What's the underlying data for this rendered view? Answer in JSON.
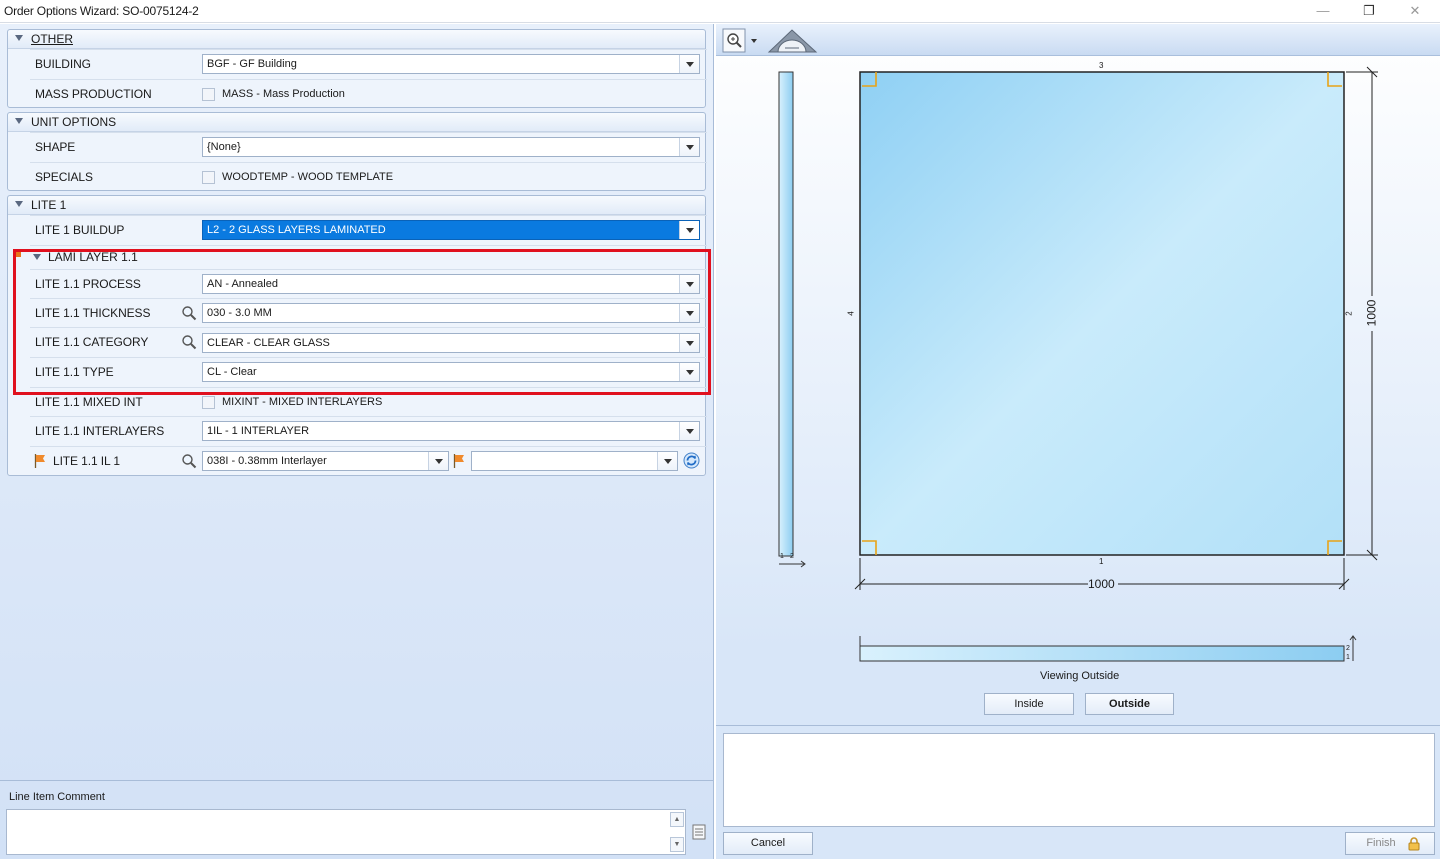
{
  "window": {
    "title": "Order Options Wizard: SO-0075124-2"
  },
  "groups": {
    "other": {
      "title": "OTHER"
    },
    "unit_options": {
      "title": "UNIT OPTIONS"
    },
    "lite1": {
      "title": "LITE 1"
    },
    "lami": {
      "title": "LAMI LAYER 1.1"
    }
  },
  "fields": {
    "building": {
      "label": "BUILDING",
      "value": "BGF - GF Building"
    },
    "mass_production": {
      "label": "MASS PRODUCTION",
      "option": "MASS - Mass Production",
      "checked": false
    },
    "shape": {
      "label": "SHAPE",
      "value": "{None}"
    },
    "specials": {
      "label": "SPECIALS",
      "option": "WOODTEMP - WOOD TEMPLATE",
      "checked": false
    },
    "lite1_buildup": {
      "label": "LITE 1 BUILDUP",
      "value": "L2 - 2 GLASS LAYERS LAMINATED"
    },
    "process": {
      "label": "LITE 1.1 PROCESS",
      "value": "AN - Annealed"
    },
    "thickness": {
      "label": "LITE 1.1 THICKNESS",
      "value": "030 - 3.0 MM"
    },
    "category": {
      "label": "LITE 1.1 CATEGORY",
      "value": "CLEAR - CLEAR GLASS"
    },
    "type": {
      "label": "LITE 1.1 TYPE",
      "value": "CL - Clear"
    },
    "mixed_int": {
      "label": "LITE 1.1 MIXED INT",
      "option": "MIXINT - MIXED INTERLAYERS",
      "checked": false
    },
    "interlayers": {
      "label": "LITE 1.1 INTERLAYERS",
      "value": "1IL - 1 INTERLAYER"
    },
    "il1": {
      "label": "LITE 1.1 IL 1",
      "value": "038I - 0.38mm Interlayer",
      "value2": ""
    }
  },
  "comment": {
    "label": "Line Item Comment",
    "value": ""
  },
  "preview": {
    "width": "1000",
    "height": "1000",
    "edge_top": "3",
    "edge_bottom": "1",
    "edge_left": "4",
    "edge_right": "2",
    "side_labels": [
      "1",
      "2"
    ],
    "viewing": "Viewing Outside",
    "inside_label": "Inside",
    "outside_label": "Outside"
  },
  "buttons": {
    "cancel": "Cancel",
    "finish": "Finish"
  },
  "colors": {
    "accent_selected": "#0a7ae0",
    "highlight_box": "#e0101e",
    "glass": "#a9dcf7",
    "corner_marker": "#e8a317"
  }
}
